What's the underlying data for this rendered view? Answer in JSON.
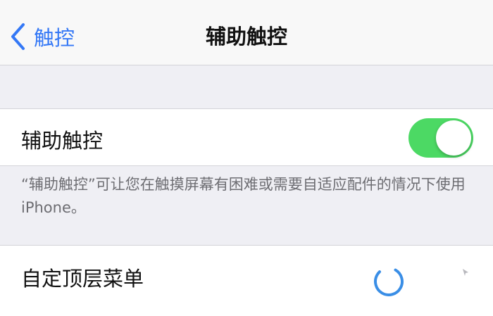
{
  "nav": {
    "back_label": "触控",
    "title": "辅助触控"
  },
  "settings": {
    "assistive_touch": {
      "label": "辅助触控",
      "enabled": true,
      "footer": "“辅助触控”可让您在触摸屏幕有困难或需要自适应配件的情况下使用iPhone。"
    },
    "customize_menu": {
      "label": "自定顶层菜单"
    }
  },
  "colors": {
    "accent": "#3478f6",
    "toggle_on": "#4cd964",
    "background": "#efeff4"
  },
  "icons": {
    "back": "chevron-left-icon",
    "assistive_button": "assistive-touch-button-icon"
  }
}
